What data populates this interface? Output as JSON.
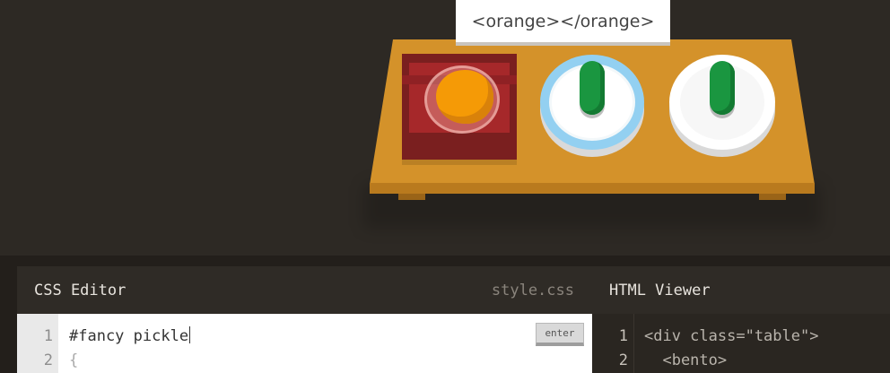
{
  "table": {
    "tooltip": "<orange></orange>",
    "items": [
      {
        "type": "bento",
        "contains": "orange"
      },
      {
        "type": "plate",
        "id": "fancy",
        "contains": "pickle"
      },
      {
        "type": "plate",
        "contains": "pickle"
      }
    ]
  },
  "css_editor": {
    "title": "CSS Editor",
    "filename": "style.css",
    "line_numbers": [
      "1",
      "2"
    ],
    "input_value": "#fancy pickle",
    "line2": "{",
    "enter_label": "enter"
  },
  "html_viewer": {
    "title": "HTML Viewer",
    "line_numbers": [
      "1",
      "2"
    ],
    "lines": [
      "<div class=\"table\">",
      "  <bento>"
    ]
  },
  "colors": {
    "background": "#2d2924",
    "table": "#d4922a",
    "bento": "#a6282a",
    "orange": "#f59a06",
    "pickle": "#1a9640",
    "plate_ring": "#93d0f1"
  }
}
